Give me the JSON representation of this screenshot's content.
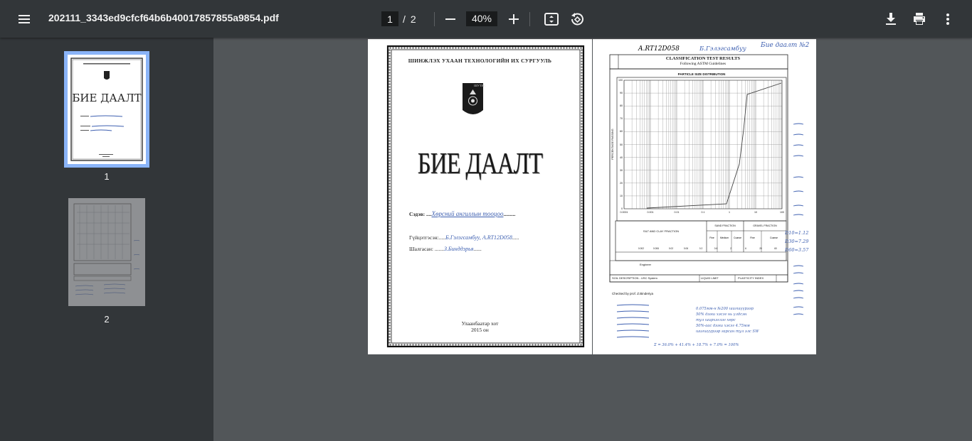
{
  "toolbar": {
    "file_name": "202111_3343ed9cfcf64b6b40017857855a9854.pdf",
    "current_page": "1",
    "page_separator": "/",
    "total_pages": "2",
    "zoom_level": "40%",
    "icons": [
      "menu-icon",
      "zoom-out-icon",
      "zoom-in-icon",
      "fit-to-page-icon",
      "rotate-icon",
      "download-icon",
      "print-icon",
      "more-options-icon"
    ]
  },
  "sidebar": {
    "thumbnails": [
      {
        "label": "1",
        "selected": true
      },
      {
        "label": "2",
        "selected": false
      }
    ]
  },
  "page1": {
    "university": "ШИНЖЛЭХ УХААН ТЕХНОЛОГИЙН ИХ СУРГУУЛЬ",
    "logo_text": "ШУТИС",
    "heading": "БИЕ ДААЛТ",
    "topic_label": "Сэдэв:",
    "topic_value": "Хөрсний ангиллын тооцоо",
    "author_label": "Гүйцэтгэсэн:",
    "author_value": "Б.Гэлэгсамбуу, А.RT12D058",
    "checker_label": "Шалгасан:",
    "checker_value": "З.Бинддэрья",
    "city": "Улаанбаатар хот",
    "year": "2015 он"
  },
  "page2": {
    "student_code": "A.RT12D058",
    "student_name": "Б.Гэлэгсамбуу",
    "assignment": "Бие даалт №2",
    "table_title": "CLASSIFICATION TEST RESULTS",
    "table_subtitle": "Following ASTM Guidelines",
    "chart_title": "PARTICLE SIZE DISTRIBUTION",
    "y_axis_label": "PERCENTAGE PASSING",
    "y_ticks": [
      "100",
      "90",
      "80",
      "70",
      "60",
      "50",
      "40",
      "30",
      "20",
      "10",
      "0"
    ],
    "x_ticks": [
      "0.0001",
      "0.001",
      "0.01",
      "0.1",
      "1",
      "10",
      "100"
    ],
    "silt_clay_label": "SILT AND CLAY FRACTION",
    "sand_label": "SAND FRACTION",
    "gravel_label": "GRAVEL FRACTION",
    "sand_cols": [
      "Fine",
      "Medium",
      "Coarse"
    ],
    "gravel_cols": [
      "Fine",
      "Coarse"
    ],
    "sieve_labels": [
      "0.002",
      "0.006",
      "0.02",
      "0.06",
      "0.2",
      "0.6",
      "2",
      "6",
      "20",
      "60"
    ],
    "engineer_label": "Engineer",
    "soil_desc_label": "SOIL DESCRIPTION - USC System",
    "liquid_limit_label": "LIQUID LIMIT",
    "plasticity_label": "PLASTICITY INDEX",
    "checked_by": "Checked by prof. Z.Binderiya",
    "d_values": [
      "D10=1.12",
      "D30=7.29",
      "D60=3.57"
    ],
    "hw_lines": [
      "0.075мм-н №200 шигшүүрээр",
      "50% дээш хэсэг нь үлдсэн",
      "тул ширхэглэг хөрс",
      "50%-аас дээш хэсэг 4.75мм",
      "шигшүүрээр гарсан тул элс SW"
    ],
    "sum_line": "Σ = 36.0% + 41.4% + 18.7% + 7.0% = 100%"
  }
}
